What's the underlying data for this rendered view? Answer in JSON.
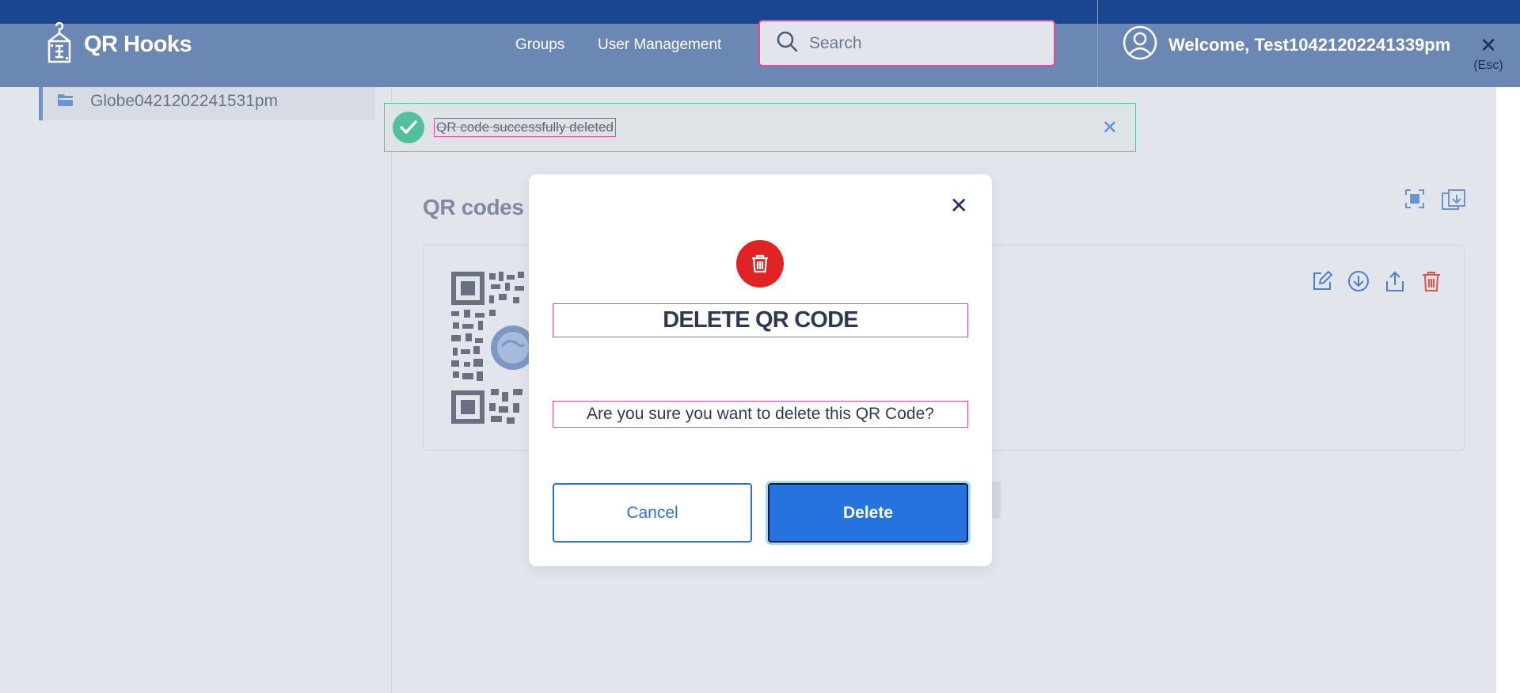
{
  "app": {
    "brand_name": "QR Hooks",
    "logo_icon": "qr-hook-logo-icon"
  },
  "nav": {
    "links": [
      "Groups",
      "User Management"
    ],
    "search_placeholder": "Search",
    "welcome_text": "Welcome, Test10421202241339pm",
    "close_label": "(Esc)"
  },
  "sidebar": {
    "items": [
      {
        "label": "Globe0421202241531pm",
        "icon": "folder-icon"
      }
    ]
  },
  "main": {
    "section_title": "QR codes"
  },
  "toast": {
    "message": "QR code successfully deleted",
    "icon": "check-icon"
  },
  "modal": {
    "title": "DELETE QR CODE",
    "message": "Are you sure you want to delete this QR Code?",
    "cancel_label": "Cancel",
    "delete_label": "Delete",
    "icon": "trash-icon"
  },
  "colors": {
    "topstripe": "#1a4590",
    "navbar": "#6b87b3",
    "accent_blue": "#2672df",
    "danger_red": "#e02424",
    "success_green": "#52c09a",
    "focus_pink": "#e24b9a"
  }
}
